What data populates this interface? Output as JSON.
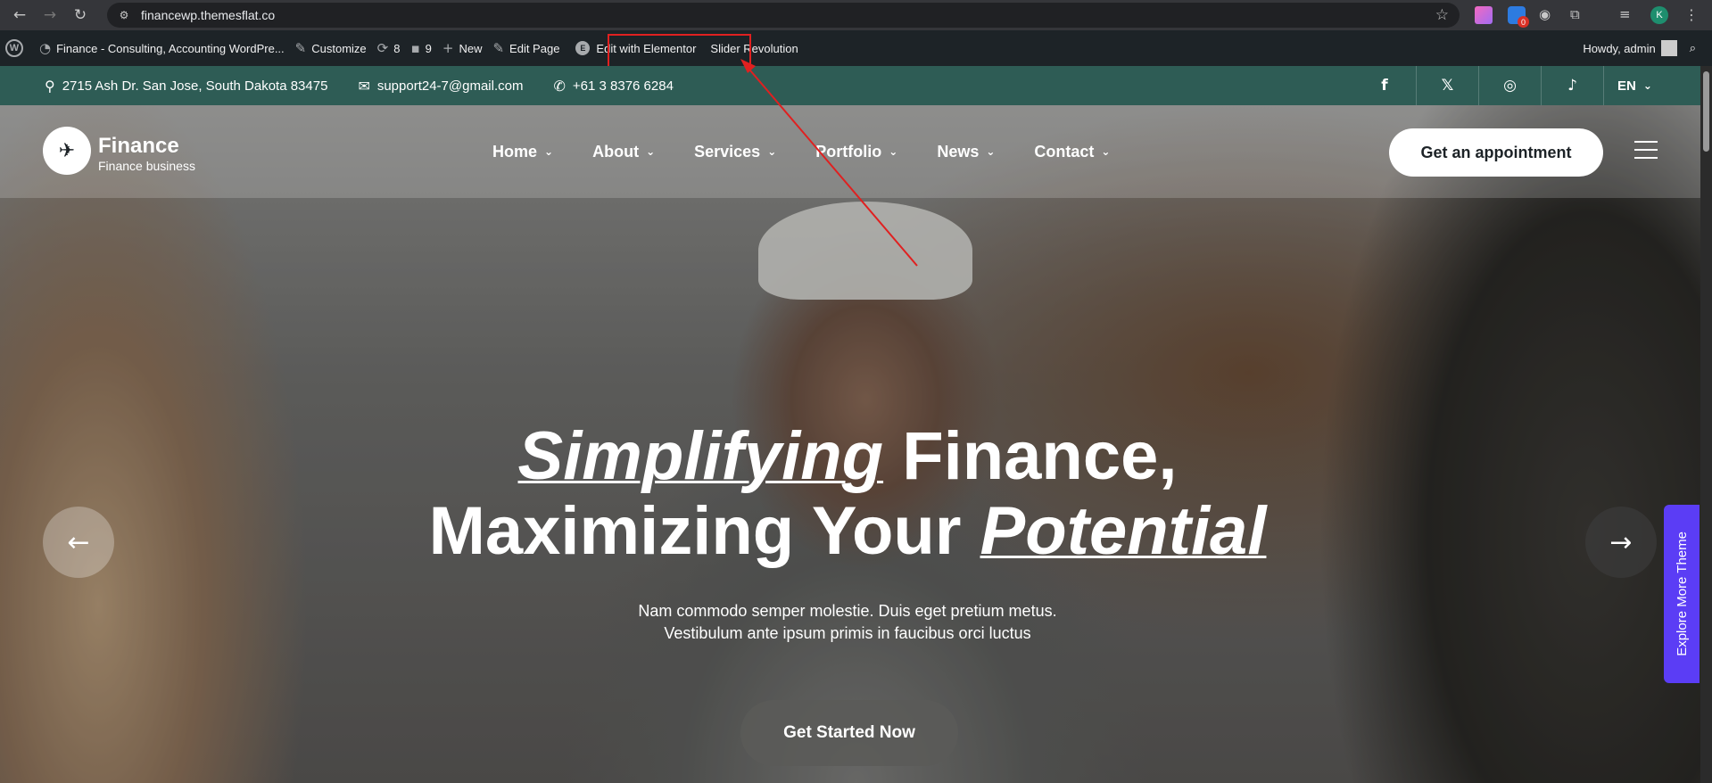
{
  "browser": {
    "url": "financewp.themesflat.co",
    "icons": [
      "back-icon",
      "forward-icon",
      "reload-icon",
      "site-info-icon",
      "bookmark-star-icon",
      "extensions-icon",
      "profile-avatar",
      "menu-icon"
    ],
    "profile_initial": "K",
    "ext_badge": "0"
  },
  "admin_bar": {
    "site_name": "Finance - Consulting, Accounting WordPre...",
    "customize": "Customize",
    "updates_count": "8",
    "comments_count": "9",
    "new": "New",
    "edit_page": "Edit Page",
    "edit_elementor": "Edit with Elementor",
    "elementor_badge": "E",
    "slider_revolution": "Slider Revolution",
    "howdy": "Howdy, admin"
  },
  "topbar": {
    "address": "2715 Ash Dr. San Jose, South Dakota 83475",
    "email": "support24-7@gmail.com",
    "phone": "+61 3 8376 6284",
    "social": [
      "f",
      "𝕏",
      "◎",
      "♪"
    ],
    "language": "EN"
  },
  "header": {
    "logo_title": "Finance",
    "logo_subtitle": "Finance business",
    "menu": [
      "Home",
      "About",
      "Services",
      "Portfolio",
      "News",
      "Contact"
    ],
    "appointment_button": "Get an appointment"
  },
  "hero": {
    "headline_italic_1": "Simplifying",
    "headline_part_1": " Finance,",
    "headline_part_2": "Maximizing Your ",
    "headline_italic_2": "Potential",
    "subtext_line_1": "Nam commodo semper molestie. Duis eget pretium metus.",
    "subtext_line_2": "Vestibulum ante ipsum primis in faucibus orci luctus",
    "cta": "Get Started Now"
  },
  "explore_tab": "Explore More Theme",
  "colors": {
    "topbar": "#2e5c55",
    "admin_bar": "#1d2327",
    "explore_tab": "#5b3df5",
    "annotation_red": "#e02020"
  }
}
